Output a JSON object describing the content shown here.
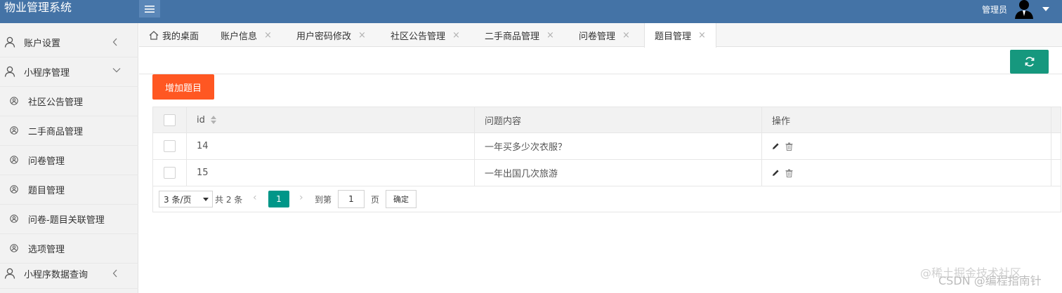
{
  "app": {
    "title": "物业管理系统"
  },
  "header": {
    "user_name": "管理员"
  },
  "sidebar": {
    "items": [
      {
        "label": "账户设置",
        "arrow": "‹"
      },
      {
        "label": "小程序管理",
        "arrow": "˅"
      },
      {
        "label": "社区公告管理"
      },
      {
        "label": "二手商品管理"
      },
      {
        "label": "问卷管理"
      },
      {
        "label": "题目管理"
      },
      {
        "label": "问卷-题目关联管理"
      },
      {
        "label": "选项管理"
      },
      {
        "label": "小程序数据查询",
        "arrow": "‹"
      }
    ]
  },
  "tabs": [
    {
      "label": "我的桌面"
    },
    {
      "label": "账户信息",
      "close": "×"
    },
    {
      "label": "用户密码修改",
      "close": "×"
    },
    {
      "label": "社区公告管理",
      "close": "×"
    },
    {
      "label": "二手商品管理",
      "close": "×"
    },
    {
      "label": "问卷管理",
      "close": "×"
    },
    {
      "label": "题目管理",
      "close": "×"
    }
  ],
  "toolbar": {
    "add_label": "增加题目"
  },
  "table": {
    "columns": [
      "id",
      "问题内容",
      "操作"
    ],
    "rows": [
      {
        "id": "14",
        "content": "一年买多少次衣服？"
      },
      {
        "id": "15",
        "content": "一年出国几次旅游"
      }
    ]
  },
  "pagination": {
    "page_size": "3 条/页",
    "total": "共 2 条",
    "current": "1",
    "goto_label": "到第",
    "goto_value": "1",
    "page_unit": "页",
    "confirm": "确定",
    "prev": "‹",
    "next": "›"
  },
  "watermark": {
    "line1": "@稀土掘金技术社区",
    "line2": "CSDN @编程指南针"
  },
  "colors": {
    "header": "#4473a6",
    "accent_green": "#009688",
    "add_button": "#ff5722",
    "refresh": "#16987e"
  }
}
